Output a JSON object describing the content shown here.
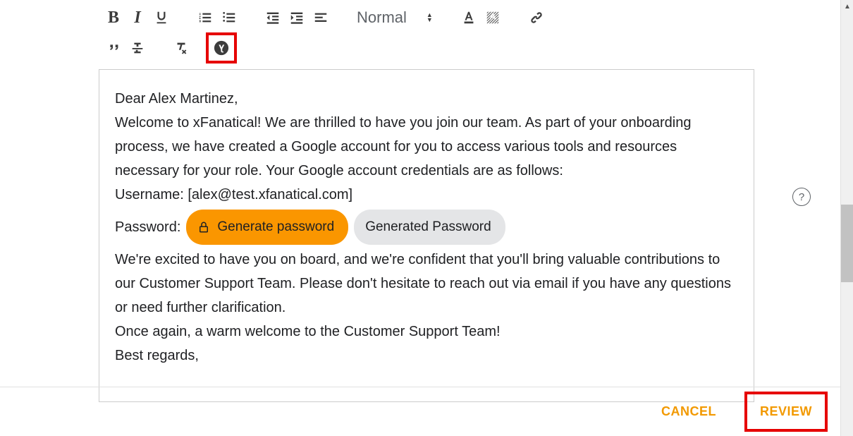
{
  "toolbar": {
    "fontsize_label": "Normal"
  },
  "email": {
    "greeting": "Dear Alex Martinez,",
    "p1": "Welcome to xFanatical! We are thrilled to have you join our team. As part of your onboarding process, we have created a Google account for you to access various tools and resources necessary for your role. Your Google account credentials are as follows:",
    "username_line": "Username: [alex@test.xfanatical.com]",
    "password_label": "Password:",
    "generate_btn": "Generate password",
    "generated_chip": "Generated Password",
    "p2": "We're excited to have you on board, and we're confident that you'll bring valuable contributions to our Customer Support Team. Please don't hesitate to reach out via email if you have any questions or need further clarification.",
    "p3": "Once again, a warm welcome to the Customer Support Team!",
    "signoff": "Best regards,"
  },
  "footer": {
    "cancel": "CANCEL",
    "review": "REVIEW"
  },
  "help_glyph": "?"
}
